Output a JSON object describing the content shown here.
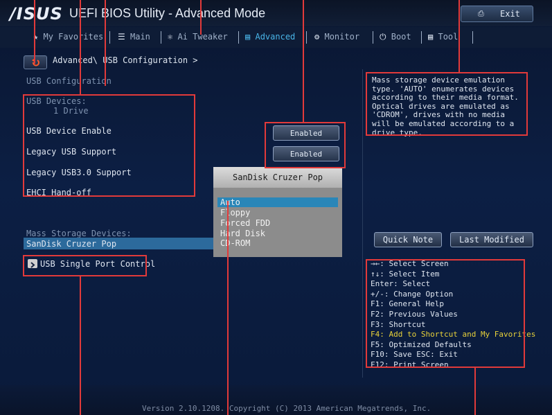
{
  "app": {
    "logo": "/ISUS",
    "title": "UEFI BIOS Utility - Advanced Mode",
    "exit_label": "Exit"
  },
  "tabs": [
    {
      "label": "My Favorites",
      "icon": "star-icon"
    },
    {
      "label": "Main",
      "icon": "menu-list-icon"
    },
    {
      "label": "Ai Tweaker",
      "icon": "tweaker-icon"
    },
    {
      "label": "Advanced",
      "icon": "advanced-icon",
      "active": true
    },
    {
      "label": "Monitor",
      "icon": "monitor-icon"
    },
    {
      "label": "Boot",
      "icon": "power-icon"
    },
    {
      "label": "Tool",
      "icon": "tool-icon"
    }
  ],
  "breadcrumb": "Advanced\\ USB Configuration >",
  "section_title": "USB Configuration",
  "usb_devices": {
    "label": "USB Devices:",
    "value": "1 Drive"
  },
  "settings": [
    {
      "label": "USB Device Enable",
      "value": "Enabled"
    },
    {
      "label": "Legacy USB Support",
      "value": "Enabled"
    },
    {
      "label": "Legacy USB3.0 Support"
    },
    {
      "label": "EHCI Hand-off"
    }
  ],
  "mass_storage": {
    "label": "Mass Storage Devices:",
    "device": "SanDisk Cruzer Pop"
  },
  "single_port": "USB Single Port Control",
  "popup": {
    "title": "SanDisk Cruzer Pop",
    "options": [
      "Auto",
      "Floppy",
      "Forced FDD",
      "Hard Disk",
      "CD-ROM"
    ],
    "selected": "Auto"
  },
  "help_text": "Mass storage device emulation type. 'AUTO' enumerates devices according to their media format. Optical drives are emulated as 'CDROM', drives with no media will be emulated according to a drive type.",
  "buttons": {
    "quick_note": "Quick Note",
    "last_modified": "Last Modified"
  },
  "keys": [
    "→←: Select Screen",
    "↑↓: Select Item",
    "Enter: Select",
    "+/-: Change Option",
    "F1: General Help",
    "F2: Previous Values",
    "F3: Shortcut",
    "F4: Add to Shortcut and My Favorites",
    "F5: Optimized Defaults",
    "F10: Save  ESC: Exit",
    "F12: Print Screen"
  ],
  "footer": "Version 2.10.1208. Copyright (C) 2013 American Megatrends, Inc.",
  "colors": {
    "accent": "#49b5e8",
    "highlight": "#2c6a9c",
    "callout": "#e23a3a",
    "shortcut": "#e8d23a"
  }
}
